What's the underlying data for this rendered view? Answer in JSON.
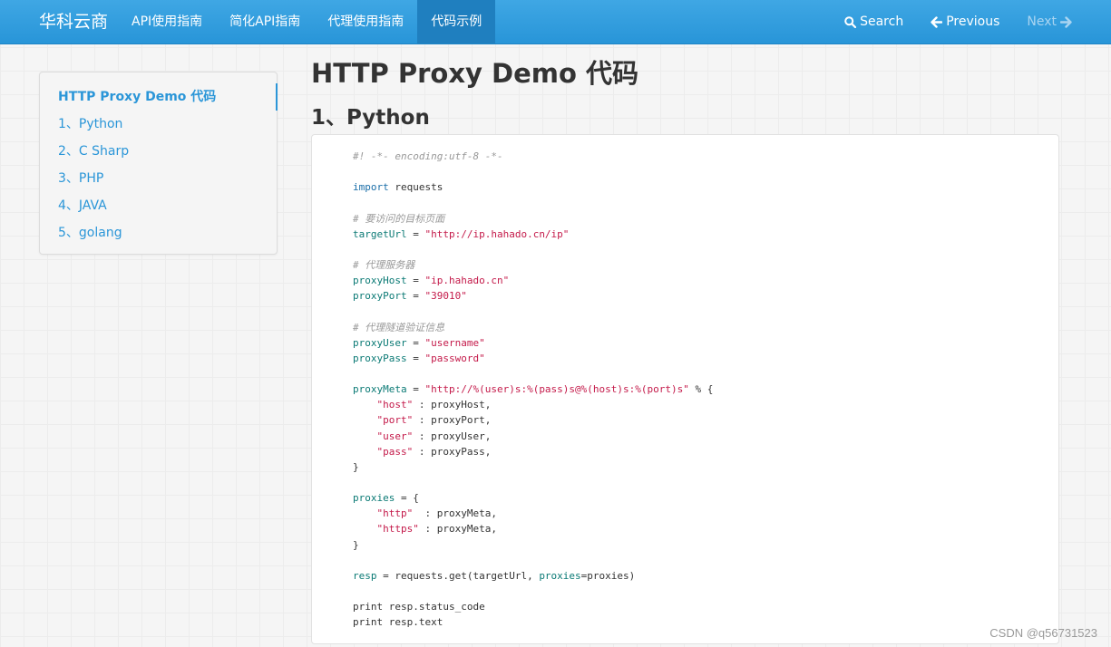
{
  "navbar": {
    "brand": "华科云商",
    "items": [
      {
        "label": "API使用指南",
        "active": false
      },
      {
        "label": "简化API指南",
        "active": false
      },
      {
        "label": "代理使用指南",
        "active": false
      },
      {
        "label": "代码示例",
        "active": true
      }
    ],
    "search_label": "Search",
    "search_icon": "search-icon",
    "previous_label": "Previous",
    "previous_icon": "arrow-left-icon",
    "next_label": "Next",
    "next_icon": "arrow-right-icon"
  },
  "sidebar": {
    "items": [
      {
        "label": "HTTP Proxy Demo 代码",
        "active": true
      },
      {
        "label": "1、Python",
        "active": false
      },
      {
        "label": "2、C Sharp",
        "active": false
      },
      {
        "label": "3、PHP",
        "active": false
      },
      {
        "label": "4、JAVA",
        "active": false
      },
      {
        "label": "5、golang",
        "active": false
      }
    ]
  },
  "main": {
    "title": "HTTP Proxy Demo 代码",
    "section_title": "1、Python",
    "code_lines": [
      [
        [
          "c",
          "#! -*- encoding:utf-8 -*-"
        ]
      ],
      [],
      [
        [
          "k",
          "import"
        ],
        [
          "p",
          " requests"
        ]
      ],
      [],
      [
        [
          "c",
          "# 要访问的目标页面"
        ]
      ],
      [
        [
          "v",
          "targetUrl"
        ],
        [
          "p",
          " = "
        ],
        [
          "s",
          "\"http://ip.hahado.cn/ip\""
        ]
      ],
      [],
      [
        [
          "c",
          "# 代理服务器"
        ]
      ],
      [
        [
          "v",
          "proxyHost"
        ],
        [
          "p",
          " = "
        ],
        [
          "s",
          "\"ip.hahado.cn\""
        ]
      ],
      [
        [
          "v",
          "proxyPort"
        ],
        [
          "p",
          " = "
        ],
        [
          "s",
          "\"39010\""
        ]
      ],
      [],
      [
        [
          "c",
          "# 代理隧道验证信息"
        ]
      ],
      [
        [
          "v",
          "proxyUser"
        ],
        [
          "p",
          " = "
        ],
        [
          "s",
          "\"username\""
        ]
      ],
      [
        [
          "v",
          "proxyPass"
        ],
        [
          "p",
          " = "
        ],
        [
          "s",
          "\"password\""
        ]
      ],
      [],
      [
        [
          "v",
          "proxyMeta"
        ],
        [
          "p",
          " = "
        ],
        [
          "s",
          "\"http://%(user)s:%(pass)s@%(host)s:%(port)s\""
        ],
        [
          "p",
          " % {"
        ]
      ],
      [
        [
          "p",
          "    "
        ],
        [
          "s",
          "\"host\""
        ],
        [
          "p",
          " : proxyHost,"
        ]
      ],
      [
        [
          "p",
          "    "
        ],
        [
          "s",
          "\"port\""
        ],
        [
          "p",
          " : proxyPort,"
        ]
      ],
      [
        [
          "p",
          "    "
        ],
        [
          "s",
          "\"user\""
        ],
        [
          "p",
          " : proxyUser,"
        ]
      ],
      [
        [
          "p",
          "    "
        ],
        [
          "s",
          "\"pass\""
        ],
        [
          "p",
          " : proxyPass,"
        ]
      ],
      [
        [
          "p",
          "}"
        ]
      ],
      [],
      [
        [
          "v",
          "proxies"
        ],
        [
          "p",
          " = {"
        ]
      ],
      [
        [
          "p",
          "    "
        ],
        [
          "s",
          "\"http\""
        ],
        [
          "p",
          "  : proxyMeta,"
        ]
      ],
      [
        [
          "p",
          "    "
        ],
        [
          "s",
          "\"https\""
        ],
        [
          "p",
          " : proxyMeta,"
        ]
      ],
      [
        [
          "p",
          "}"
        ]
      ],
      [],
      [
        [
          "v",
          "resp"
        ],
        [
          "p",
          " = requests.get(targetUrl, "
        ],
        [
          "v",
          "proxies"
        ],
        [
          "p",
          "=proxies)"
        ]
      ],
      [],
      [
        [
          "p",
          "print resp.status_code"
        ]
      ],
      [
        [
          "p",
          "print resp.text"
        ]
      ]
    ]
  },
  "watermark": "CSDN @q56731523",
  "colors": {
    "navbar": "#2895d8",
    "active_nav": "#1f7fbf",
    "link": "#2b96d8",
    "comment": "#999999",
    "keyword": "#1a6ea8",
    "variable": "#0b7a75",
    "string": "#c41a4a"
  }
}
